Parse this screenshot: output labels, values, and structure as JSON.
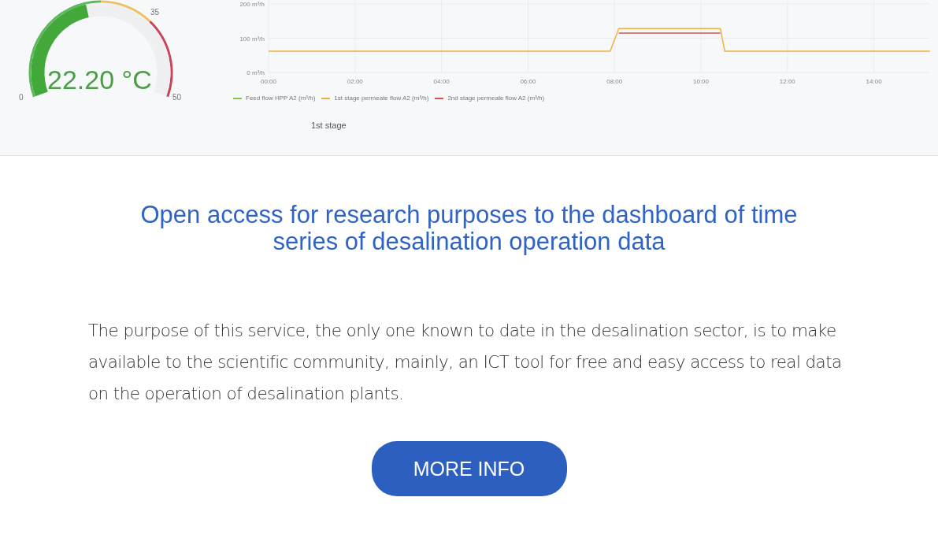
{
  "dashboard_preview": {
    "gauge": {
      "value": "22.20 °C",
      "level": 0.444,
      "min_label": "0",
      "mark_label": "35",
      "max_label": "50"
    },
    "chart": {
      "chart_data": {
        "type": "line",
        "grid": true,
        "xlim": [
          0,
          15.3
        ],
        "x": [
          0,
          2,
          4,
          6,
          7.9,
          8.1,
          10.45,
          10.55,
          12,
          14,
          15.3
        ],
        "xticks": [
          {
            "value": 0,
            "label": "00:00"
          },
          {
            "value": 2,
            "label": "02:00"
          },
          {
            "value": 4,
            "label": "04:00"
          },
          {
            "value": 6,
            "label": "06:00"
          },
          {
            "value": 8,
            "label": "08:00"
          },
          {
            "value": 10,
            "label": "10:00"
          },
          {
            "value": 12,
            "label": "12:00"
          },
          {
            "value": 14,
            "label": "14:00"
          }
        ],
        "yticks": [
          {
            "value": 0,
            "label": "0 m³/h"
          },
          {
            "value": 100,
            "label": "100 m³/h"
          },
          {
            "value": 200,
            "label": "200 m³/h"
          }
        ],
        "ylim": [
          0,
          200
        ],
        "series": [
          {
            "name": "Feed flow HPP A2 (m³/h)",
            "color": "#8bc34a",
            "values": [
              null,
              null,
              null,
              null,
              null,
              null,
              null,
              null,
              null,
              null,
              null
            ]
          },
          {
            "name": "1st stage permeate flow A2 (m³/h)",
            "color": "#f0b040",
            "values": [
              62,
              62,
              62,
              62,
              62,
              128,
              128,
              62,
              62,
              62,
              62
            ]
          },
          {
            "name": "2nd stage permeate flow A2 (m³/h)",
            "color": "#d9534f",
            "values": [
              null,
              null,
              null,
              null,
              null,
              115,
              115,
              null,
              null,
              null,
              null
            ]
          }
        ]
      }
    },
    "panel_title": "1st stage"
  },
  "title": "Open access for research purposes to the dashboard of time series of desalination operation data",
  "description": "The purpose of this service, the only one known to date in the desalination sector, is to make available to the scientific community, mainly, an ICT tool for free and easy access to real data on the operation of desalination plants.",
  "button": "MORE INFO"
}
